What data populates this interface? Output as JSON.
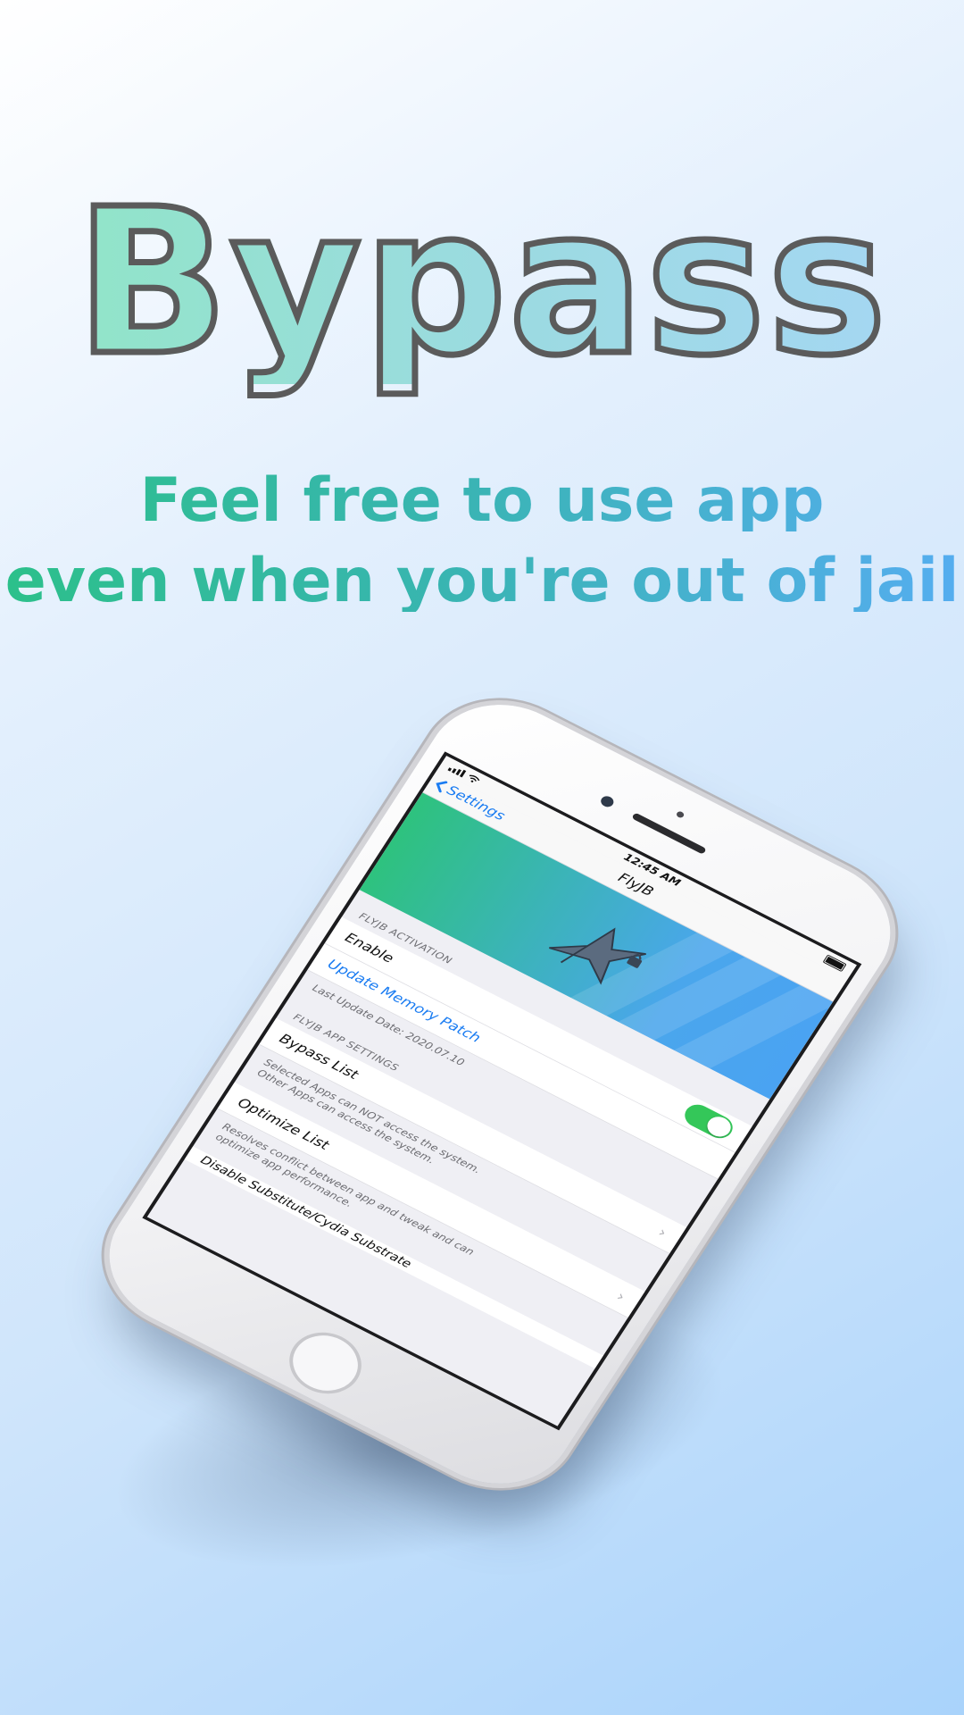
{
  "promo": {
    "title": "Bypass",
    "tagline_line1": "Feel free to use app",
    "tagline_line2": "even when you're out of jail"
  },
  "status_bar": {
    "time": "12:45 AM"
  },
  "nav": {
    "back_label": "Settings",
    "title": "FlyJB"
  },
  "sections": {
    "activation_header": "FLYJB ACTIVATION",
    "enable_label": "Enable",
    "enable_on": true,
    "update_patch_label": "Update Memory Patch",
    "last_update": "Last Update Date: 2020.07.10",
    "app_settings_header": "FLYJB APP SETTINGS",
    "bypass_list_label": "Bypass List",
    "bypass_note_line1": "Selected Apps can NOT access the system.",
    "bypass_note_line2": "Other Apps can access the system.",
    "optimize_list_label": "Optimize List",
    "optimize_note_line1": "Resolves conflict between app and tweak and can",
    "optimize_note_line2": "optimize app performance.",
    "next_row_partial": "Disable Substitute/Cydia Substrate"
  },
  "colors": {
    "accent_blue": "#1a7cf2",
    "toggle_green": "#34c759",
    "banner_green": "#2ec27e",
    "banner_blue": "#4aa3f2",
    "title_stroke": "#5b5b5b"
  },
  "icons": {
    "back": "chevron-left-icon",
    "disclosure": "chevron-right-icon",
    "banner": "bird-with-lock-icon"
  }
}
